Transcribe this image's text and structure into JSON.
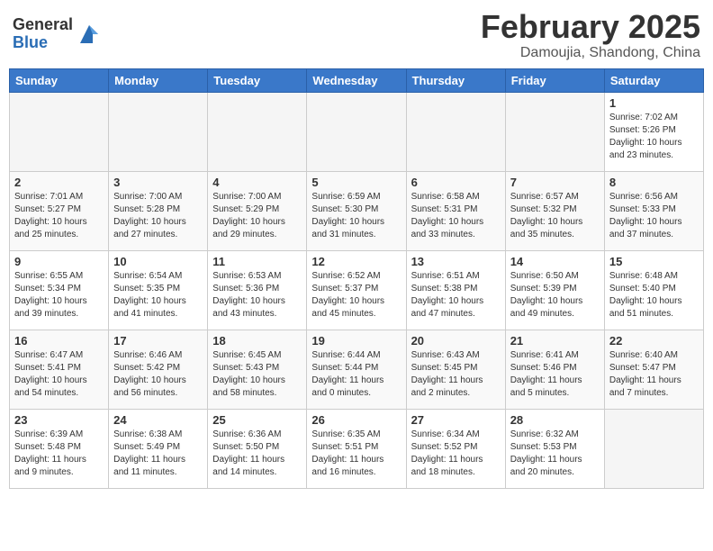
{
  "header": {
    "logo_general": "General",
    "logo_blue": "Blue",
    "month": "February 2025",
    "location": "Damoujia, Shandong, China"
  },
  "weekdays": [
    "Sunday",
    "Monday",
    "Tuesday",
    "Wednesday",
    "Thursday",
    "Friday",
    "Saturday"
  ],
  "weeks": [
    [
      {
        "day": "",
        "info": ""
      },
      {
        "day": "",
        "info": ""
      },
      {
        "day": "",
        "info": ""
      },
      {
        "day": "",
        "info": ""
      },
      {
        "day": "",
        "info": ""
      },
      {
        "day": "",
        "info": ""
      },
      {
        "day": "1",
        "info": "Sunrise: 7:02 AM\nSunset: 5:26 PM\nDaylight: 10 hours and 23 minutes."
      }
    ],
    [
      {
        "day": "2",
        "info": "Sunrise: 7:01 AM\nSunset: 5:27 PM\nDaylight: 10 hours and 25 minutes."
      },
      {
        "day": "3",
        "info": "Sunrise: 7:00 AM\nSunset: 5:28 PM\nDaylight: 10 hours and 27 minutes."
      },
      {
        "day": "4",
        "info": "Sunrise: 7:00 AM\nSunset: 5:29 PM\nDaylight: 10 hours and 29 minutes."
      },
      {
        "day": "5",
        "info": "Sunrise: 6:59 AM\nSunset: 5:30 PM\nDaylight: 10 hours and 31 minutes."
      },
      {
        "day": "6",
        "info": "Sunrise: 6:58 AM\nSunset: 5:31 PM\nDaylight: 10 hours and 33 minutes."
      },
      {
        "day": "7",
        "info": "Sunrise: 6:57 AM\nSunset: 5:32 PM\nDaylight: 10 hours and 35 minutes."
      },
      {
        "day": "8",
        "info": "Sunrise: 6:56 AM\nSunset: 5:33 PM\nDaylight: 10 hours and 37 minutes."
      }
    ],
    [
      {
        "day": "9",
        "info": "Sunrise: 6:55 AM\nSunset: 5:34 PM\nDaylight: 10 hours and 39 minutes."
      },
      {
        "day": "10",
        "info": "Sunrise: 6:54 AM\nSunset: 5:35 PM\nDaylight: 10 hours and 41 minutes."
      },
      {
        "day": "11",
        "info": "Sunrise: 6:53 AM\nSunset: 5:36 PM\nDaylight: 10 hours and 43 minutes."
      },
      {
        "day": "12",
        "info": "Sunrise: 6:52 AM\nSunset: 5:37 PM\nDaylight: 10 hours and 45 minutes."
      },
      {
        "day": "13",
        "info": "Sunrise: 6:51 AM\nSunset: 5:38 PM\nDaylight: 10 hours and 47 minutes."
      },
      {
        "day": "14",
        "info": "Sunrise: 6:50 AM\nSunset: 5:39 PM\nDaylight: 10 hours and 49 minutes."
      },
      {
        "day": "15",
        "info": "Sunrise: 6:48 AM\nSunset: 5:40 PM\nDaylight: 10 hours and 51 minutes."
      }
    ],
    [
      {
        "day": "16",
        "info": "Sunrise: 6:47 AM\nSunset: 5:41 PM\nDaylight: 10 hours and 54 minutes."
      },
      {
        "day": "17",
        "info": "Sunrise: 6:46 AM\nSunset: 5:42 PM\nDaylight: 10 hours and 56 minutes."
      },
      {
        "day": "18",
        "info": "Sunrise: 6:45 AM\nSunset: 5:43 PM\nDaylight: 10 hours and 58 minutes."
      },
      {
        "day": "19",
        "info": "Sunrise: 6:44 AM\nSunset: 5:44 PM\nDaylight: 11 hours and 0 minutes."
      },
      {
        "day": "20",
        "info": "Sunrise: 6:43 AM\nSunset: 5:45 PM\nDaylight: 11 hours and 2 minutes."
      },
      {
        "day": "21",
        "info": "Sunrise: 6:41 AM\nSunset: 5:46 PM\nDaylight: 11 hours and 5 minutes."
      },
      {
        "day": "22",
        "info": "Sunrise: 6:40 AM\nSunset: 5:47 PM\nDaylight: 11 hours and 7 minutes."
      }
    ],
    [
      {
        "day": "23",
        "info": "Sunrise: 6:39 AM\nSunset: 5:48 PM\nDaylight: 11 hours and 9 minutes."
      },
      {
        "day": "24",
        "info": "Sunrise: 6:38 AM\nSunset: 5:49 PM\nDaylight: 11 hours and 11 minutes."
      },
      {
        "day": "25",
        "info": "Sunrise: 6:36 AM\nSunset: 5:50 PM\nDaylight: 11 hours and 14 minutes."
      },
      {
        "day": "26",
        "info": "Sunrise: 6:35 AM\nSunset: 5:51 PM\nDaylight: 11 hours and 16 minutes."
      },
      {
        "day": "27",
        "info": "Sunrise: 6:34 AM\nSunset: 5:52 PM\nDaylight: 11 hours and 18 minutes."
      },
      {
        "day": "28",
        "info": "Sunrise: 6:32 AM\nSunset: 5:53 PM\nDaylight: 11 hours and 20 minutes."
      },
      {
        "day": "",
        "info": ""
      }
    ]
  ]
}
